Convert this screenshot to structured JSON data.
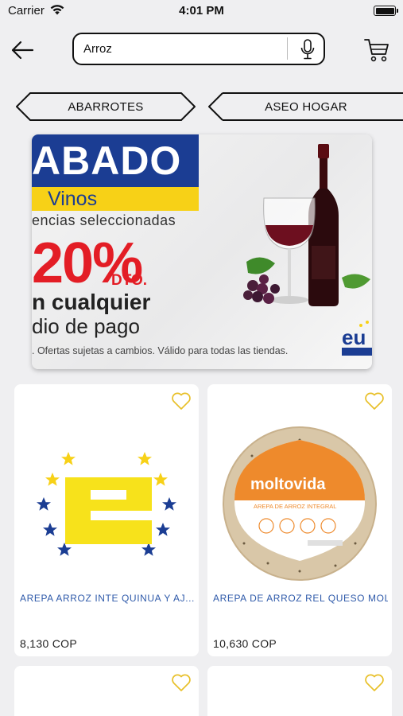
{
  "status_bar": {
    "carrier": "Carrier",
    "time": "4:01 PM"
  },
  "header": {
    "search_value": "Arroz",
    "back_icon": "arrow-left-icon",
    "mic_icon": "microphone-icon",
    "cart_icon": "cart-icon"
  },
  "categories": [
    {
      "label": "ABARROTES"
    },
    {
      "label": "ASEO HOGAR"
    }
  ],
  "banner": {
    "headline": "ABADO",
    "subhead": "Vinos",
    "tagline": "encias seleccionadas",
    "discount": "20%",
    "discount_suffix": "DTO.",
    "line1": "n cualquier",
    "line2": "dio de pago",
    "disclaimer": ". Ofertas sujetas a cambios. Válido para todas las tiendas.",
    "logo_text": "eu"
  },
  "products": [
    {
      "name": "AREPA ARROZ INTE QUINUA Y AJ...",
      "price": "8,130 COP",
      "favorite": false
    },
    {
      "name": "AREPA DE ARROZ REL QUESO MOL...",
      "price": "10,630 COP",
      "favorite": false,
      "package_brand": "moltovida",
      "package_label": "AREPA DE ARROZ INTEGRAL"
    },
    {
      "name": "",
      "price": "",
      "favorite": false
    },
    {
      "name": "",
      "price": "",
      "favorite": false
    }
  ],
  "colors": {
    "brand_blue": "#1b3d93",
    "brand_yellow": "#f7d117",
    "discount_red": "#e31d25",
    "product_name": "#2f5aaa",
    "heart_outline": "#e8c02a"
  }
}
